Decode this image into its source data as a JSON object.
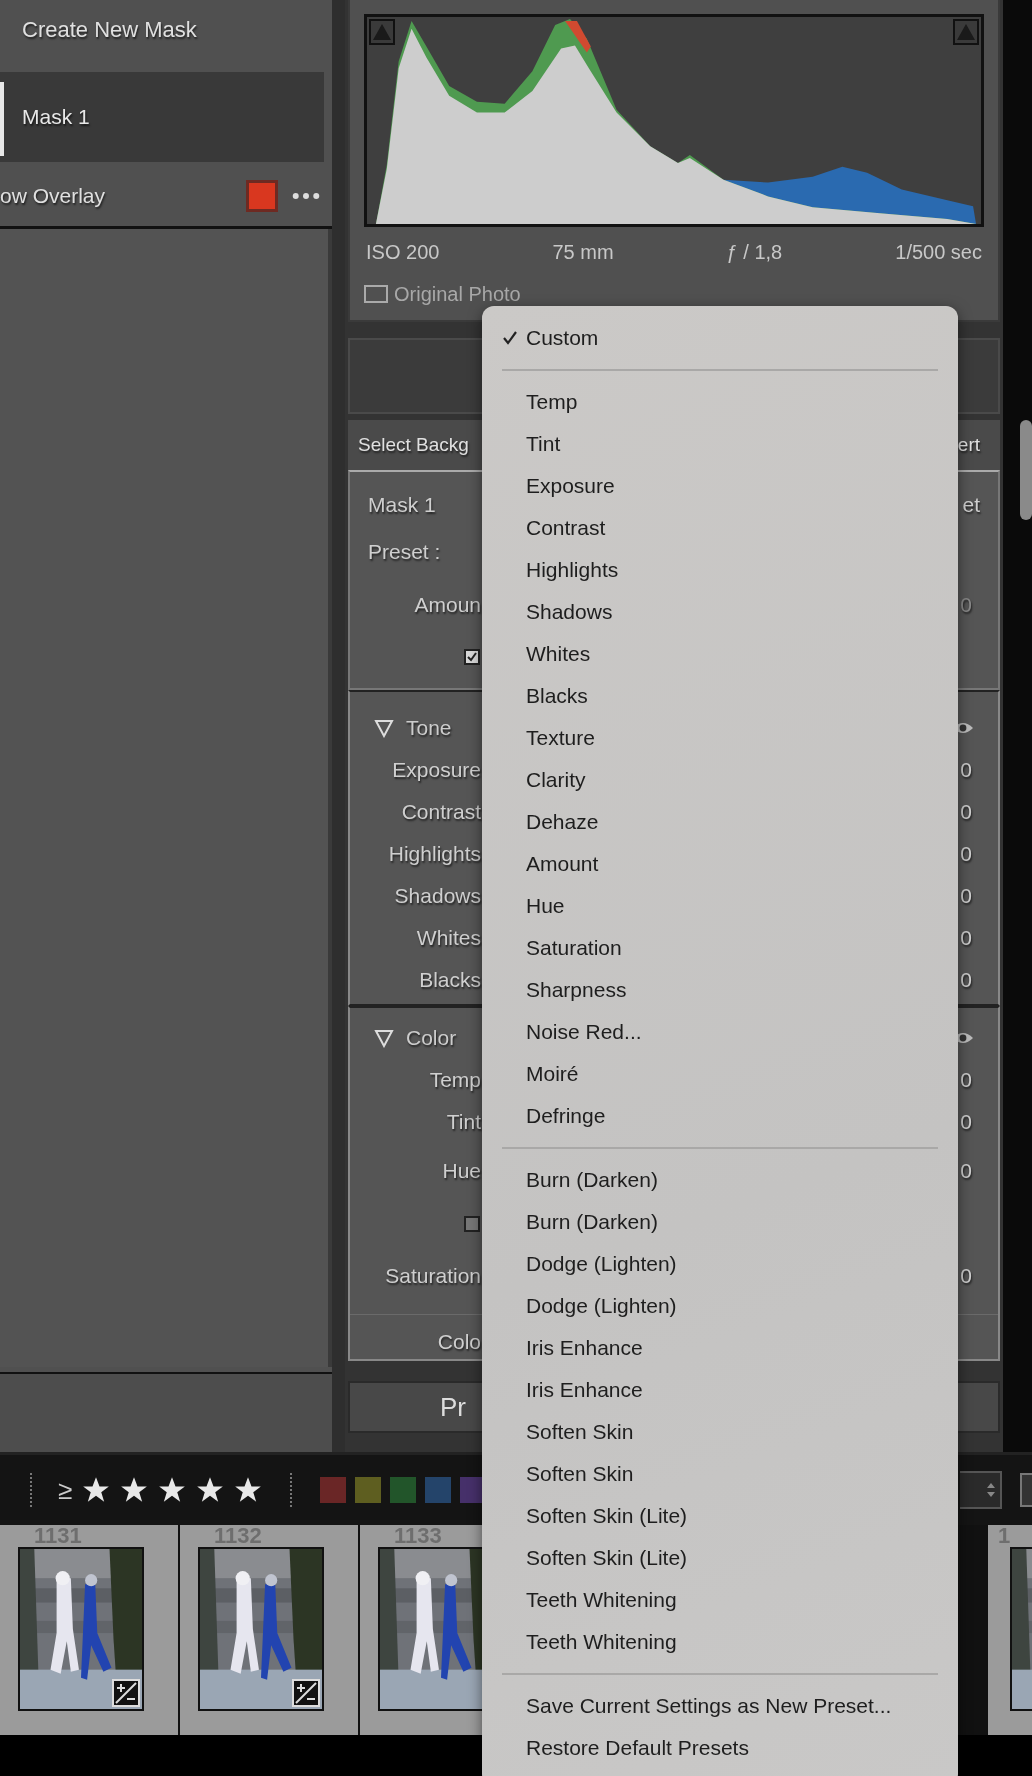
{
  "mask_panel": {
    "create_label": "Create New Mask",
    "masks": [
      {
        "name": "Mask 1",
        "selected": true
      }
    ],
    "overlay_label": "ow Overlay"
  },
  "histogram": {
    "iso": "ISO 200",
    "focal_length": "75 mm",
    "aperture": "ƒ / 1,8",
    "shutter": "1/500 sec",
    "original_photo": {
      "label": "Original Photo",
      "checked": false
    }
  },
  "mask_settings": {
    "select_label": "Select Backg",
    "invert_label": "ert",
    "mask_name": "Mask 1",
    "reset_label": "et",
    "preset_label": "Preset :",
    "amount_label": "Amoun",
    "amount_value": "0",
    "checkbox": {
      "checked": true
    }
  },
  "tone": {
    "title": "Tone",
    "expanded": true,
    "rows": [
      {
        "label": "Exposure",
        "value": "0"
      },
      {
        "label": "Contrast",
        "value": "0"
      },
      {
        "label": "Highlights",
        "value": "0"
      },
      {
        "label": "Shadows",
        "value": "0"
      },
      {
        "label": "Whites",
        "value": "0"
      },
      {
        "label": "Blacks",
        "value": "0"
      }
    ]
  },
  "color": {
    "title": "Color",
    "expanded": true,
    "rows": [
      {
        "kind": "slider",
        "label": "Temp",
        "value": "0"
      },
      {
        "kind": "slider",
        "label": "Tint",
        "value": "0"
      },
      {
        "kind": "slider",
        "label": "Hue",
        "value": "0"
      },
      {
        "kind": "checkbox",
        "checked": false
      },
      {
        "kind": "slider",
        "label": "Saturation",
        "value": "0"
      },
      {
        "kind": "divider"
      },
      {
        "kind": "slider",
        "label": "Colo"
      }
    ]
  },
  "presets_button": "Pr",
  "menu": {
    "items": [
      {
        "kind": "item",
        "label": "Custom",
        "checked": true
      },
      {
        "kind": "separator"
      },
      {
        "kind": "item",
        "label": "Temp",
        "checked": false
      },
      {
        "kind": "item",
        "label": "Tint",
        "checked": false
      },
      {
        "kind": "item",
        "label": "Exposure",
        "checked": false
      },
      {
        "kind": "item",
        "label": "Contrast",
        "checked": false
      },
      {
        "kind": "item",
        "label": "Highlights",
        "checked": false
      },
      {
        "kind": "item",
        "label": "Shadows",
        "checked": false
      },
      {
        "kind": "item",
        "label": "Whites",
        "checked": false
      },
      {
        "kind": "item",
        "label": "Blacks",
        "checked": false
      },
      {
        "kind": "item",
        "label": "Texture",
        "checked": false
      },
      {
        "kind": "item",
        "label": "Clarity",
        "checked": false
      },
      {
        "kind": "item",
        "label": "Dehaze",
        "checked": false
      },
      {
        "kind": "item",
        "label": "Amount",
        "checked": false
      },
      {
        "kind": "item",
        "label": "Hue",
        "checked": false
      },
      {
        "kind": "item",
        "label": "Saturation",
        "checked": false
      },
      {
        "kind": "item",
        "label": "Sharpness",
        "checked": false
      },
      {
        "kind": "item",
        "label": "Noise Red...",
        "checked": false
      },
      {
        "kind": "item",
        "label": "Moiré",
        "checked": false
      },
      {
        "kind": "item",
        "label": "Defringe",
        "checked": false
      },
      {
        "kind": "separator"
      },
      {
        "kind": "item",
        "label": "Burn (Darken)",
        "checked": false
      },
      {
        "kind": "item",
        "label": "Burn (Darken)",
        "checked": false
      },
      {
        "kind": "item",
        "label": "Dodge (Lighten)",
        "checked": false
      },
      {
        "kind": "item",
        "label": "Dodge (Lighten)",
        "checked": false
      },
      {
        "kind": "item",
        "label": "Iris Enhance",
        "checked": false
      },
      {
        "kind": "item",
        "label": "Iris Enhance",
        "checked": false
      },
      {
        "kind": "item",
        "label": "Soften Skin",
        "checked": false
      },
      {
        "kind": "item",
        "label": "Soften Skin",
        "checked": false
      },
      {
        "kind": "item",
        "label": "Soften Skin (Lite)",
        "checked": false
      },
      {
        "kind": "item",
        "label": "Soften Skin (Lite)",
        "checked": false
      },
      {
        "kind": "item",
        "label": "Teeth Whitening",
        "checked": false
      },
      {
        "kind": "item",
        "label": "Teeth Whitening",
        "checked": false
      },
      {
        "kind": "separator"
      },
      {
        "kind": "item",
        "label": "Save Current Settings as New Preset...",
        "checked": false
      },
      {
        "kind": "item",
        "label": "Restore Default Presets",
        "checked": false
      }
    ]
  },
  "filmstrip": {
    "toolbar": {
      "rating_operator": "≥",
      "stars": 5,
      "color_labels": [
        {
          "color": "#6a2626"
        },
        {
          "color": "#5e5e20"
        },
        {
          "color": "#22552a"
        },
        {
          "color": "#24446a"
        },
        {
          "color": "#46306a"
        }
      ]
    },
    "thumbnails": [
      {
        "number": "1131",
        "kind": "picture",
        "edited": true
      },
      {
        "number": "1132",
        "kind": "picture",
        "edited": true
      },
      {
        "number": "1133",
        "kind": "picture"
      },
      {
        "number": "1",
        "kind": "picture"
      }
    ]
  }
}
